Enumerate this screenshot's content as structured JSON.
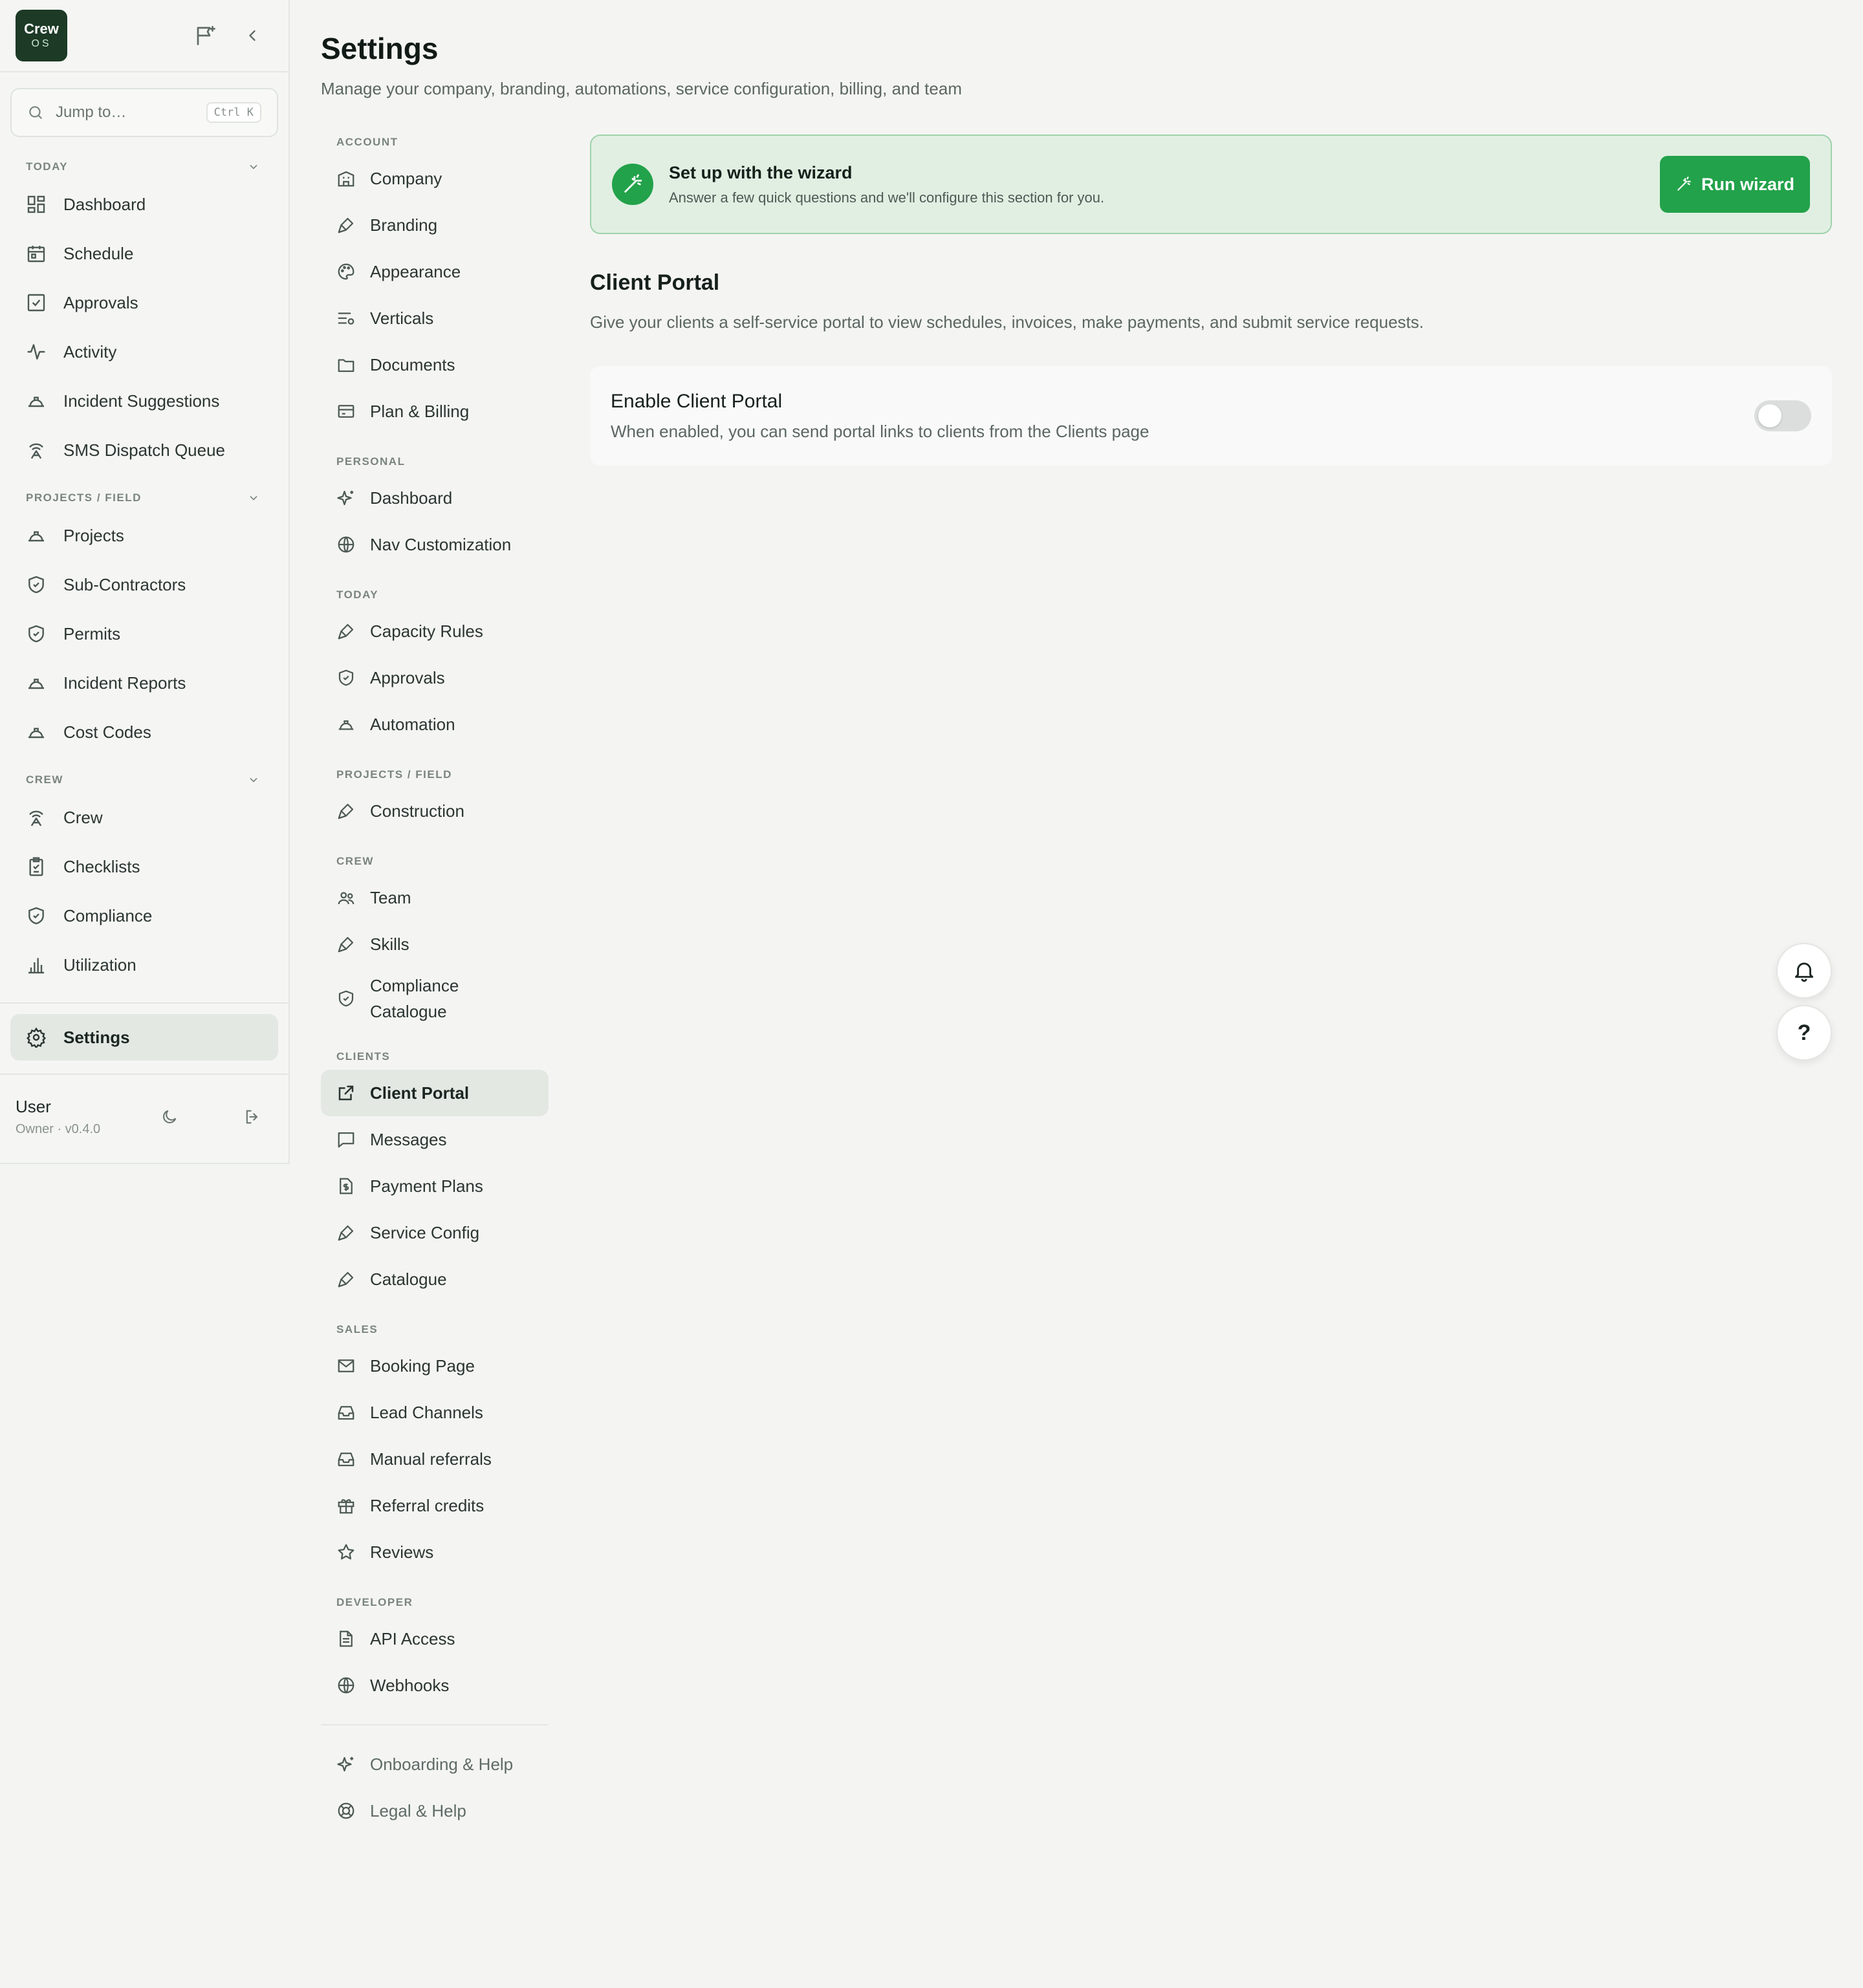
{
  "logo": {
    "line1": "Crew",
    "line2": "OS"
  },
  "search": {
    "placeholder": "Jump to…",
    "shortcut": "Ctrl K"
  },
  "sidebar": {
    "sections": [
      {
        "title": "TODAY",
        "items": [
          {
            "label": "Dashboard",
            "icon": "dashboard-icon"
          },
          {
            "label": "Schedule",
            "icon": "calendar-icon"
          },
          {
            "label": "Approvals",
            "icon": "check-square-icon"
          },
          {
            "label": "Activity",
            "icon": "activity-icon"
          },
          {
            "label": "Incident Suggestions",
            "icon": "hard-hat-icon"
          },
          {
            "label": "SMS Dispatch Queue",
            "icon": "radio-tower-icon"
          }
        ]
      },
      {
        "title": "PROJECTS / FIELD",
        "items": [
          {
            "label": "Projects",
            "icon": "hard-hat-icon"
          },
          {
            "label": "Sub-Contractors",
            "icon": "shield-check-icon"
          },
          {
            "label": "Permits",
            "icon": "shield-check-icon"
          },
          {
            "label": "Incident Reports",
            "icon": "hard-hat-icon"
          },
          {
            "label": "Cost Codes",
            "icon": "hard-hat-icon"
          }
        ]
      },
      {
        "title": "CREW",
        "items": [
          {
            "label": "Crew",
            "icon": "radio-tower-icon"
          },
          {
            "label": "Checklists",
            "icon": "clipboard-icon"
          },
          {
            "label": "Compliance",
            "icon": "shield-check-icon"
          },
          {
            "label": "Utilization",
            "icon": "bar-chart-icon"
          }
        ]
      }
    ],
    "active": {
      "label": "Settings",
      "icon": "gear-icon"
    },
    "user": {
      "name": "User",
      "role": "Owner · v0.4.0"
    }
  },
  "page": {
    "title": "Settings",
    "subtitle": "Manage your company, branding, automations, service configuration, billing, and team"
  },
  "settings_nav": {
    "groups": [
      {
        "title": "ACCOUNT",
        "items": [
          {
            "label": "Company",
            "icon": "building-icon"
          },
          {
            "label": "Branding",
            "icon": "brush-icon"
          },
          {
            "label": "Appearance",
            "icon": "palette-icon"
          },
          {
            "label": "Verticals",
            "icon": "list-settings-icon"
          },
          {
            "label": "Documents",
            "icon": "folder-icon"
          },
          {
            "label": "Plan & Billing",
            "icon": "credit-card-icon"
          }
        ]
      },
      {
        "title": "PERSONAL",
        "items": [
          {
            "label": "Dashboard",
            "icon": "sparkles-icon"
          },
          {
            "label": "Nav Customization",
            "icon": "globe-icon"
          }
        ]
      },
      {
        "title": "TODAY",
        "items": [
          {
            "label": "Capacity Rules",
            "icon": "brush-icon"
          },
          {
            "label": "Approvals",
            "icon": "shield-check-icon"
          },
          {
            "label": "Automation",
            "icon": "hard-hat-icon"
          }
        ]
      },
      {
        "title": "PROJECTS / FIELD",
        "items": [
          {
            "label": "Construction",
            "icon": "brush-icon"
          }
        ]
      },
      {
        "title": "CREW",
        "items": [
          {
            "label": "Team",
            "icon": "users-icon"
          },
          {
            "label": "Skills",
            "icon": "brush-icon"
          },
          {
            "label": "Compliance Catalogue",
            "icon": "shield-check-icon"
          }
        ]
      },
      {
        "title": "CLIENTS",
        "items": [
          {
            "label": "Client Portal",
            "icon": "external-link-icon",
            "active": true
          },
          {
            "label": "Messages",
            "icon": "message-icon"
          },
          {
            "label": "Payment Plans",
            "icon": "file-dollar-icon"
          },
          {
            "label": "Service Config",
            "icon": "brush-icon"
          },
          {
            "label": "Catalogue",
            "icon": "brush-icon"
          }
        ]
      },
      {
        "title": "SALES",
        "items": [
          {
            "label": "Booking Page",
            "icon": "mail-icon"
          },
          {
            "label": "Lead Channels",
            "icon": "inbox-icon"
          },
          {
            "label": "Manual referrals",
            "icon": "inbox-icon"
          },
          {
            "label": "Referral credits",
            "icon": "gift-icon"
          },
          {
            "label": "Reviews",
            "icon": "star-icon"
          }
        ]
      },
      {
        "title": "DEVELOPER",
        "items": [
          {
            "label": "API Access",
            "icon": "file-text-icon"
          },
          {
            "label": "Webhooks",
            "icon": "globe-icon"
          }
        ]
      }
    ],
    "footer": [
      {
        "label": "Onboarding & Help",
        "icon": "sparkles-icon"
      },
      {
        "label": "Legal & Help",
        "icon": "life-buoy-icon"
      }
    ]
  },
  "wizard": {
    "title": "Set up with the wizard",
    "description": "Answer a few quick questions and we'll configure this section for you.",
    "button": "Run wizard"
  },
  "client_portal": {
    "title": "Client Portal",
    "description": "Give your clients a self-service portal to view schedules, invoices, make payments, and submit service requests.",
    "setting_title": "Enable Client Portal",
    "setting_desc": "When enabled, you can send portal links to clients from the Clients page",
    "enabled": false
  },
  "fab": {
    "help_label": "?"
  },
  "colors": {
    "accent": "#22a24a",
    "logo_bg": "#1c3a26",
    "active_bg": "#e3e8e2"
  }
}
